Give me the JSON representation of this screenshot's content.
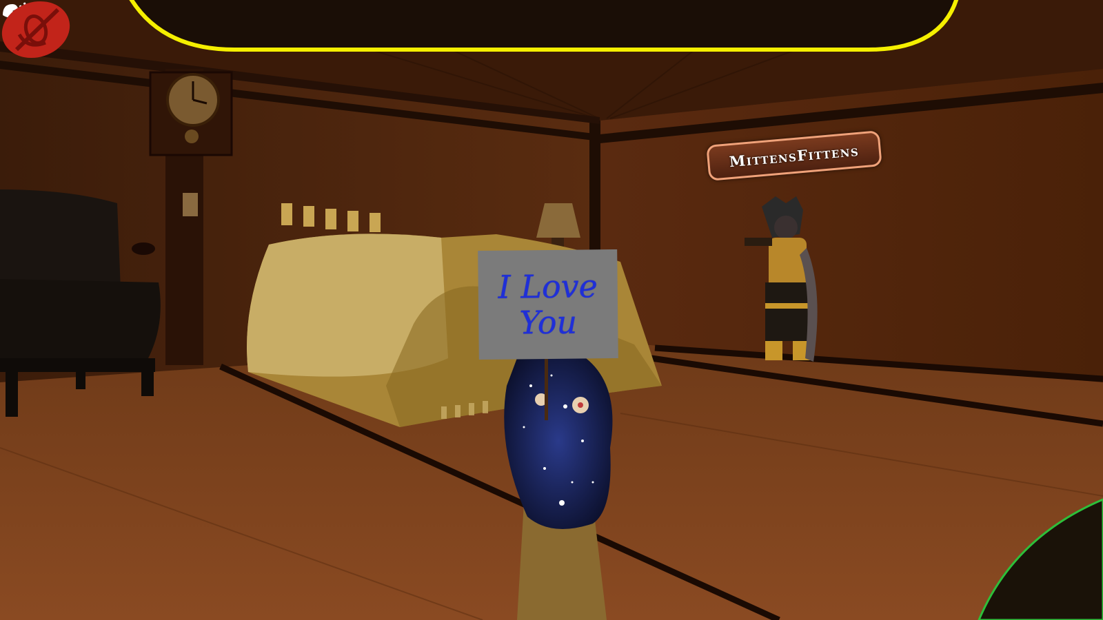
{
  "hud": {
    "sign_text": "I Love You",
    "player_name": "MittensFittens",
    "icons": {
      "speaking": "speaker-talking-icon",
      "mic": "microphone-muted-icon"
    },
    "colors": {
      "banner_outline": "#f5ef00",
      "nameplate_border": "#f0a27a",
      "sign_text": "#1f2fd8",
      "mic_badge": "#c2241a"
    }
  }
}
